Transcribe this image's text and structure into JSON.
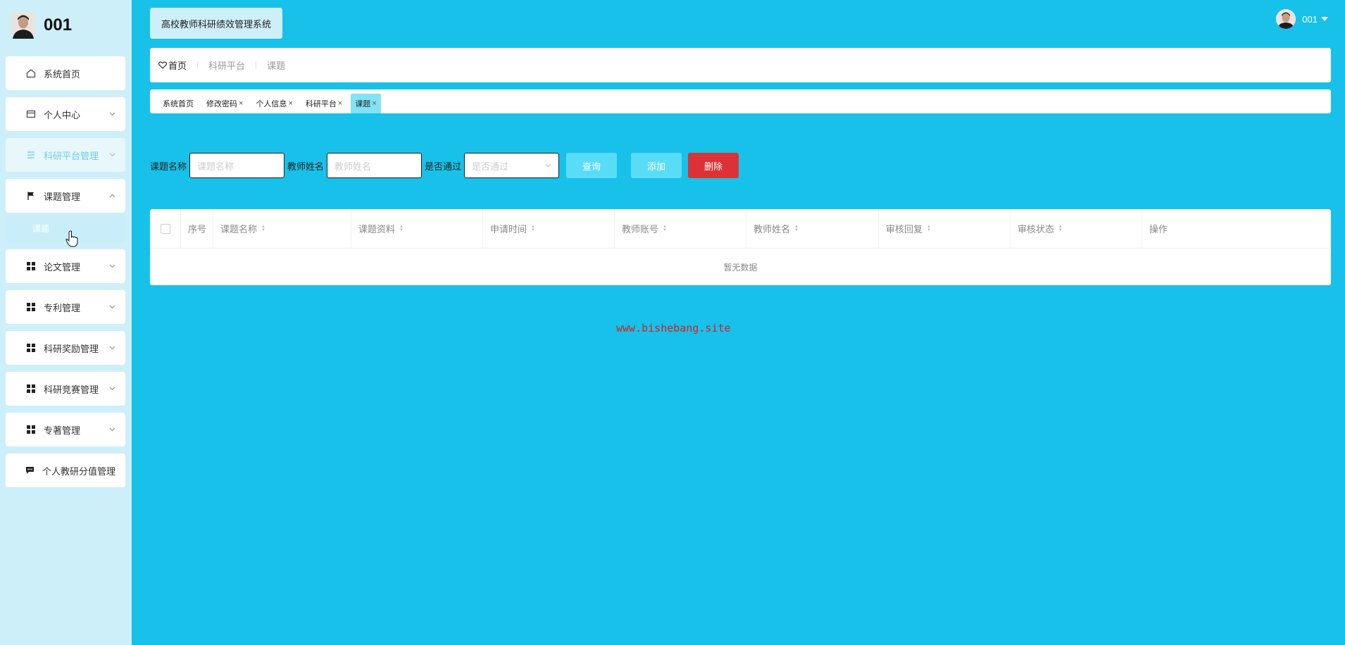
{
  "sidebar": {
    "username": "001",
    "items": [
      {
        "label": "系统首页",
        "icon": "home-icon",
        "chevron": false
      },
      {
        "label": "个人中心",
        "icon": "wallet-icon",
        "chevron": true
      },
      {
        "label": "科研平台管理",
        "icon": "list-icon",
        "chevron": true
      },
      {
        "label": "课题管理",
        "icon": "flag-icon",
        "chevron": "up"
      },
      {
        "label": "论文管理",
        "icon": "grid-icon",
        "chevron": true
      },
      {
        "label": "专利管理",
        "icon": "grid-icon",
        "chevron": true
      },
      {
        "label": "科研奖励管理",
        "icon": "grid-icon",
        "chevron": true
      },
      {
        "label": "科研竞赛管理",
        "icon": "grid-icon",
        "chevron": true
      },
      {
        "label": "专著管理",
        "icon": "grid-icon",
        "chevron": true
      },
      {
        "label": "个人教研分值管理",
        "icon": "message-icon",
        "chevron": false
      }
    ],
    "submenu_label": "课题"
  },
  "header": {
    "system_title": "高校教师科研绩效管理系统",
    "user": "001"
  },
  "breadcrumb": {
    "home": "首页",
    "items": [
      "科研平台",
      "课题"
    ]
  },
  "tabs": [
    {
      "label": "系统首页",
      "closable": false
    },
    {
      "label": "修改密码",
      "closable": true
    },
    {
      "label": "个人信息",
      "closable": true
    },
    {
      "label": "科研平台",
      "closable": true
    },
    {
      "label": "课题",
      "closable": true,
      "active": true
    }
  ],
  "search": {
    "topic_label": "课题名称",
    "topic_placeholder": "课题名称",
    "teacher_label": "教师姓名",
    "teacher_placeholder": "教师姓名",
    "passed_label": "是否通过",
    "passed_placeholder": "是否通过",
    "query_button": "查询",
    "add_button": "添加",
    "delete_button": "删除"
  },
  "table": {
    "columns": [
      "序号",
      "课题名称",
      "课题资料",
      "申请时间",
      "教师账号",
      "教师姓名",
      "审核回复",
      "审核状态",
      "操作"
    ],
    "empty_text": "暂无数据"
  },
  "watermark": "www.bishebang.site",
  "colors": {
    "main_bg": "#17c1ea",
    "sidebar_bg": "#cdeff9",
    "accent": "#59ddf7",
    "danger": "#dc3237"
  }
}
